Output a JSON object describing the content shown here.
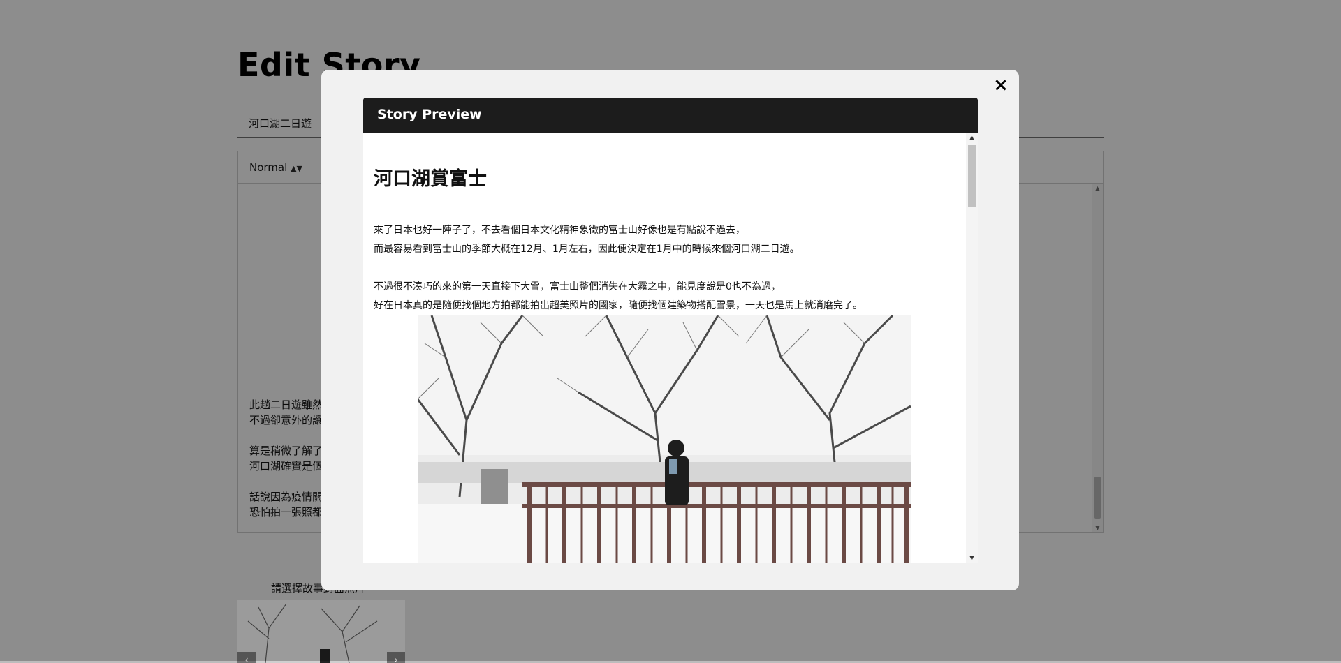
{
  "page": {
    "title": "Edit Story",
    "title_input_value": "河口湖二日遊",
    "editor": {
      "format_select": "Normal",
      "lines": [
        "此趟二日遊雖然",
        "不過卻意外的讓",
        "",
        "算是稍微了解了",
        "河口湖確實是個",
        "",
        "話說因為疫情關",
        "恐怕拍一張照都"
      ]
    },
    "cover_label": "請選擇故事封面照片",
    "cover_prev": "‹",
    "cover_next": "›"
  },
  "modal": {
    "close_label": "×",
    "header": "Story Preview",
    "heading": "河口湖賞富士",
    "paragraphs": [
      "來了日本也好一陣子了，不去看個日本文化精神象徵的富士山好像也是有點說不過去，",
      "而最容易看到富士山的季節大概在12月、1月左右，因此便決定在1月中的時候來個河口湖二日遊。",
      "",
      "不過很不湊巧的來的第一天直接下大雪，富士山整個消失在大霧之中，能見度說是0也不為過，",
      "好在日本真的是隨便找個地方拍都能拍出超美照片的國家，隨便找個建築物搭配雪景，一天也是馬上就消磨完了。"
    ],
    "photo_icon": "snow-bridge-photo"
  },
  "colors": {
    "overlay": "#000000",
    "modal_bg": "#f1f1f1",
    "header_bg": "#1c1c1c",
    "bridge": "#6b4a45"
  }
}
